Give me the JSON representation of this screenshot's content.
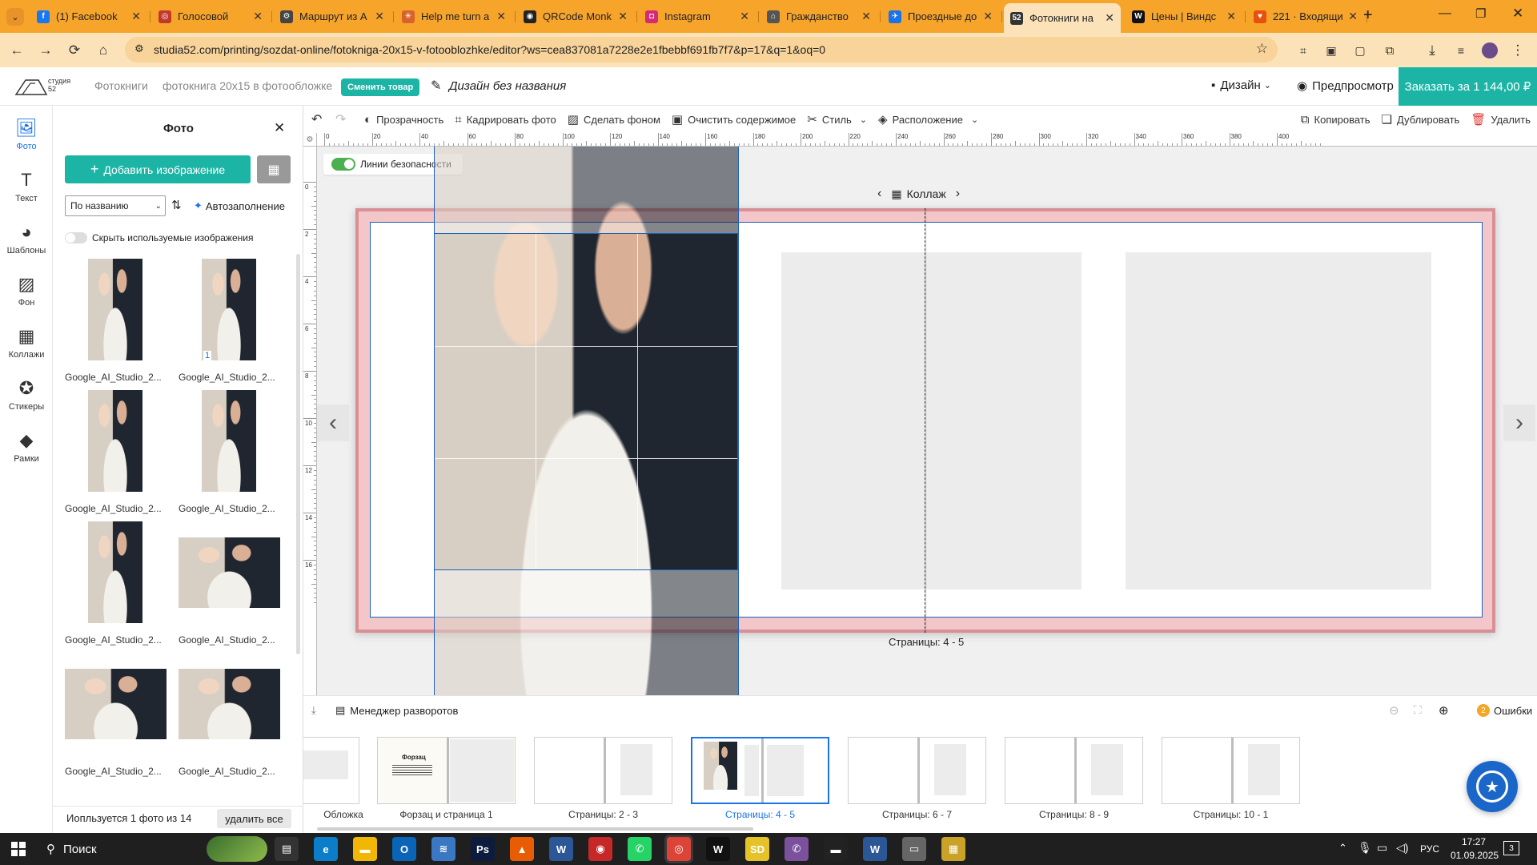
{
  "browser": {
    "tabs": [
      {
        "title": "(1) Facebook",
        "icon": "facebook-icon",
        "color": "#1877f2",
        "glyph": "f"
      },
      {
        "title": "Голосовой",
        "icon": "voice-icon",
        "color": "#c0392b",
        "glyph": "◎"
      },
      {
        "title": "Маршрут из А",
        "icon": "route-icon",
        "color": "#444444",
        "glyph": "⚙"
      },
      {
        "title": "Help me turn a",
        "icon": "claude-icon",
        "color": "#d9622b",
        "glyph": "✳"
      },
      {
        "title": "QRCode Monk",
        "icon": "qr-icon",
        "color": "#222222",
        "glyph": "◉"
      },
      {
        "title": "Instagram",
        "icon": "instagram-icon",
        "color": "#d62976",
        "glyph": "◘"
      },
      {
        "title": "Гражданство",
        "icon": "gov-icon",
        "color": "#555555",
        "glyph": "⌂"
      },
      {
        "title": "Проездные до",
        "icon": "tickets-icon",
        "color": "#1a73e8",
        "glyph": "✈"
      },
      {
        "title": "Фотокниги на",
        "icon": "studia52-icon",
        "color": "#333333",
        "glyph": "52",
        "active": true
      },
      {
        "title": "Цены | Виндс",
        "icon": "w-icon",
        "color": "#111111",
        "glyph": "W"
      },
      {
        "title": "221 · Входящи",
        "icon": "mail-icon",
        "color": "#e8500e",
        "glyph": "♥"
      }
    ],
    "new_tab": "+",
    "url": "studia52.com/printing/sozdat-online/fotokniga-20x15-v-fotooblozhke/editor?ws=cea837081a7228e2e1fbebbf691fb7f7&p=17&q=1&oq=0"
  },
  "header": {
    "logo": "студия 52",
    "breadcrumb": [
      "Фотокниги",
      "фотокнига 20x15 в фотообложке"
    ],
    "change_product": "Сменить товар",
    "design_name": "Дизайн без названия",
    "design_menu": "Дизайн",
    "preview": "Предпросмотр",
    "order": "Заказать за 1 144,00 ₽",
    "accent": "#1cb5a5"
  },
  "rail": [
    {
      "label": "Фото",
      "icon": "photo-icon",
      "active": true
    },
    {
      "label": "Текст",
      "icon": "text-icon"
    },
    {
      "label": "Шаблоны",
      "icon": "palette-icon"
    },
    {
      "label": "Фон",
      "icon": "background-icon"
    },
    {
      "label": "Коллажи",
      "icon": "collage-icon"
    },
    {
      "label": "Стикеры",
      "icon": "sticker-icon"
    },
    {
      "label": "Рамки",
      "icon": "frames-icon"
    }
  ],
  "panel": {
    "title": "Фото",
    "add_image": "Добавить изображение",
    "sort_value": "По названию",
    "autofill": "Автозаполнение",
    "hide_used": "Скрыть используемые изображения",
    "photos": [
      {
        "caption": "Google_AI_Studio_2...",
        "badge": ""
      },
      {
        "caption": "Google_AI_Studio_2...",
        "badge": "1"
      },
      {
        "caption": "Google_AI_Studio_2...",
        "badge": ""
      },
      {
        "caption": "Google_AI_Studio_2...",
        "badge": ""
      },
      {
        "caption": "Google_AI_Studio_2...",
        "badge": ""
      },
      {
        "caption": "Google_AI_Studio_2...",
        "badge": ""
      },
      {
        "caption": "Google_AI_Studio_2...",
        "badge": ""
      },
      {
        "caption": "Google_AI_Studio_2...",
        "badge": ""
      }
    ],
    "used_info": "Иопльзуется 1 фото из 14",
    "delete_all": "удалить все"
  },
  "toolbar": {
    "undo": "undo",
    "redo": "redo",
    "items": [
      {
        "label": "Прозрачность",
        "icon": "opacity-icon"
      },
      {
        "label": "Кадрировать фото",
        "icon": "crop-icon"
      },
      {
        "label": "Сделать фоном",
        "icon": "set-background-icon"
      },
      {
        "label": "Очистить содержимое",
        "icon": "clear-icon"
      },
      {
        "label": "Стиль",
        "icon": "style-icon"
      },
      {
        "label": "Расположение",
        "icon": "layers-icon"
      }
    ],
    "copy": "Копировать",
    "duplicate": "Дублировать",
    "delete": "Удалить"
  },
  "ruler": {
    "top_ticks": [
      "0",
      "20",
      "40",
      "60",
      "80",
      "100",
      "120",
      "140",
      "160",
      "180",
      "200",
      "220",
      "240",
      "260",
      "280",
      "300",
      "320",
      "340",
      "360",
      "380",
      "400"
    ],
    "left_ticks": [
      "0",
      "2",
      "4",
      "6",
      "8",
      "10",
      "12",
      "14",
      "16"
    ]
  },
  "canvas": {
    "safety_lines": "Линии безопасности",
    "layout_label": "Коллаж",
    "page_label": "Страницы: 4 - 5"
  },
  "bottombar": {
    "spread_manager": "Менеджер разворотов",
    "errors_count": "2",
    "errors": "Ошибки"
  },
  "spreads": [
    {
      "label": "Обложка",
      "kind": "cover"
    },
    {
      "label": "Форзац и страница 1",
      "kind": "endpaper",
      "mini_title": "Форзац"
    },
    {
      "label": "Страницы: 2 - 3",
      "kind": "single"
    },
    {
      "label": "Страницы: 4 - 5",
      "kind": "current",
      "active": true
    },
    {
      "label": "Страницы: 6 - 7",
      "kind": "single"
    },
    {
      "label": "Страницы: 8 - 9",
      "kind": "single"
    },
    {
      "label": "Страницы: 10 - 1",
      "kind": "single"
    }
  ],
  "taskbar": {
    "search": "Поиск",
    "lang": "РУС",
    "time": "17:27",
    "date": "01.09.2025",
    "notifications": "3"
  }
}
